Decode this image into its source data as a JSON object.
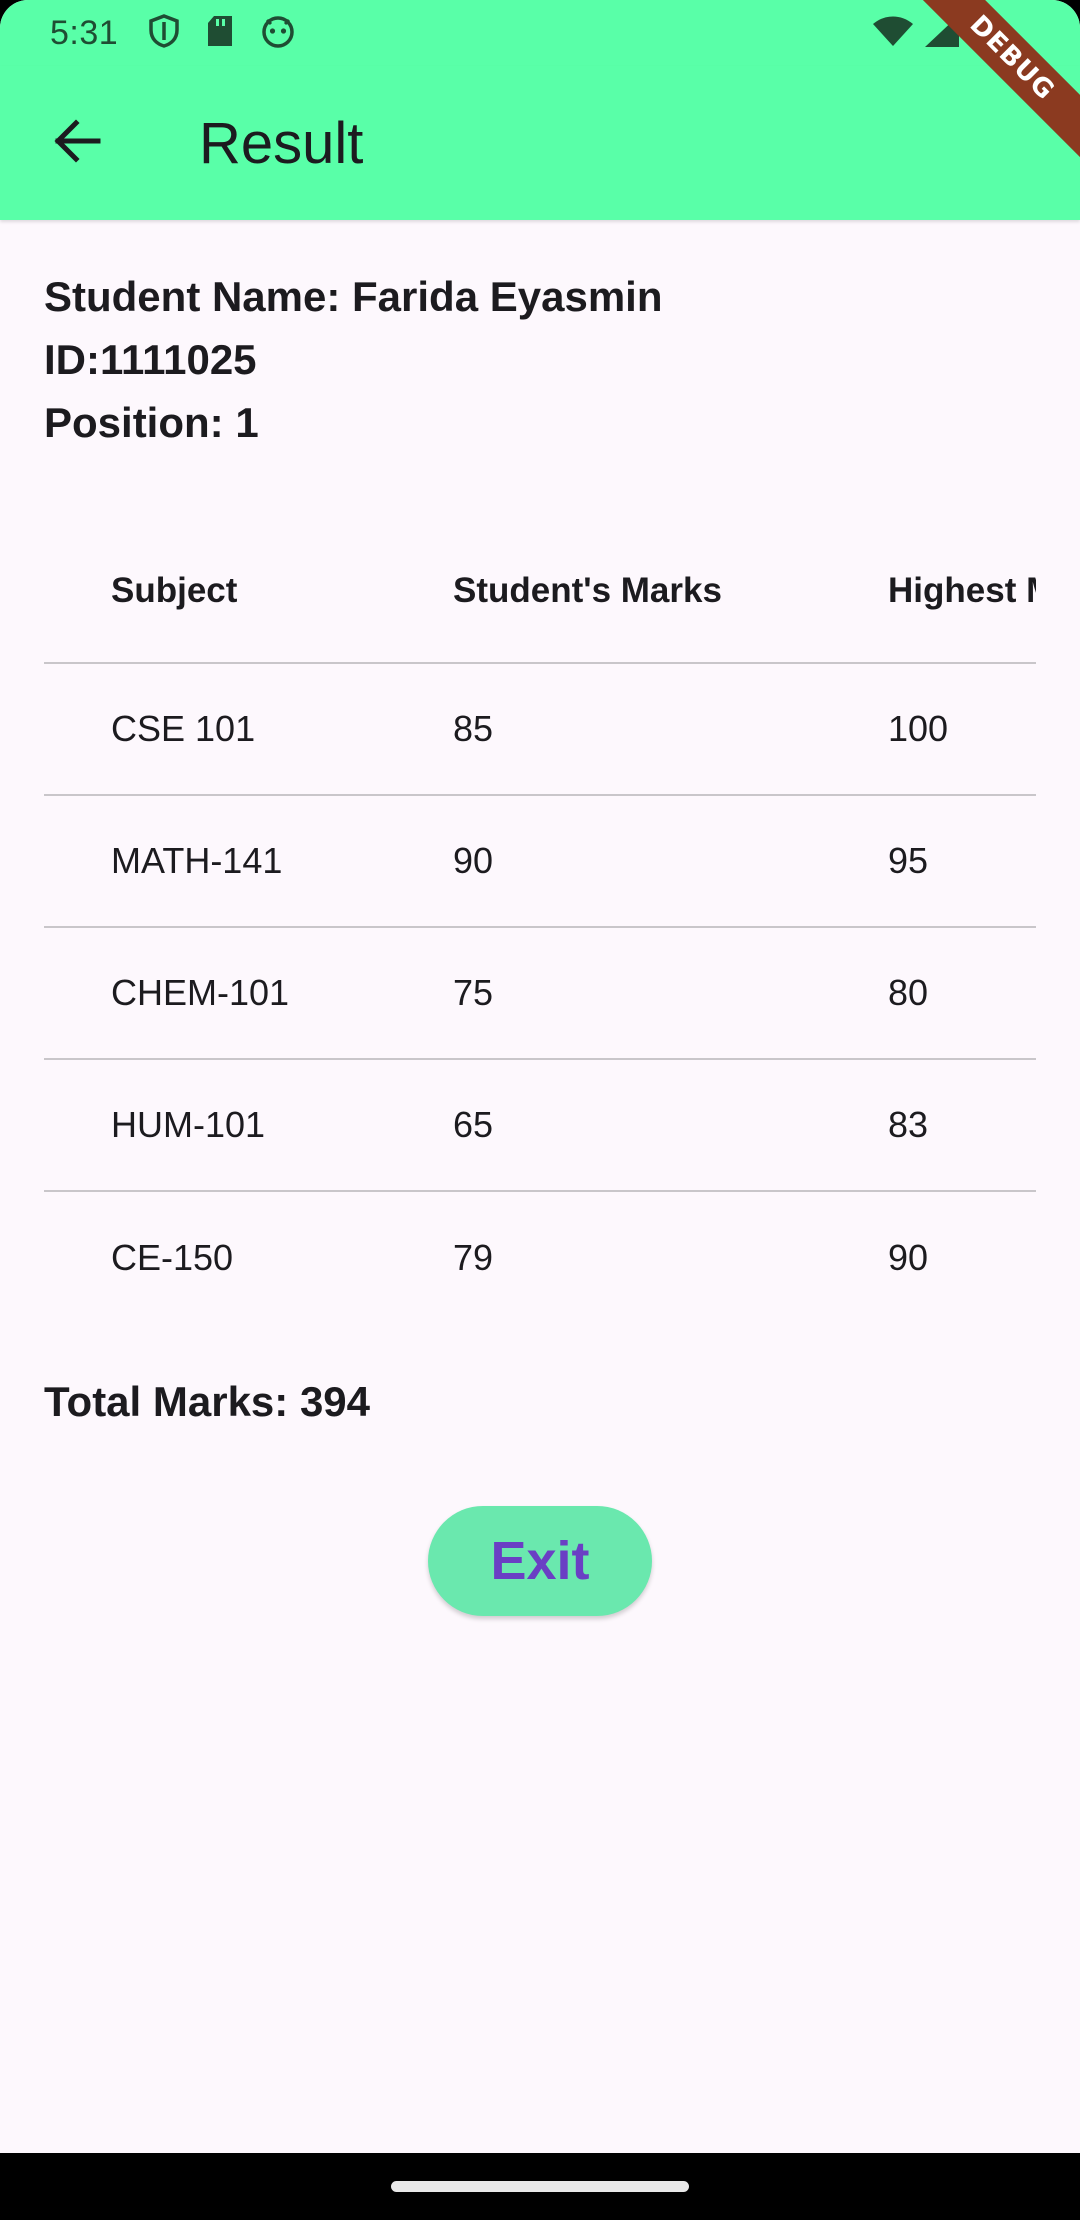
{
  "status_bar": {
    "time": "5:31",
    "left_icons": [
      "shield-icon",
      "sd-card-icon",
      "android-icon"
    ],
    "right_icons": [
      "wifi-icon",
      "cell-signal-icon",
      "battery-icon"
    ]
  },
  "app_bar": {
    "title": "Result",
    "back_icon": "arrow-back-icon",
    "color": "#59ffa8"
  },
  "debug_banner": "DEBUG",
  "student": {
    "name_line": "Student Name: Farida Eyasmin",
    "id_line": "ID:1111025",
    "position_line": "Position: 1"
  },
  "table": {
    "headers": [
      "Subject",
      "Student's Marks",
      "Highest Marks"
    ],
    "rows": [
      [
        "CSE 101",
        "85",
        "100"
      ],
      [
        "MATH-141",
        "90",
        "95"
      ],
      [
        "CHEM-101",
        "75",
        "80"
      ],
      [
        "HUM-101",
        "65",
        "83"
      ],
      [
        "CE-150",
        "79",
        "90"
      ]
    ]
  },
  "total_line": "Total Marks: 394",
  "exit_button": {
    "label": "Exit",
    "bg_color": "#6ae8ae",
    "text_color": "#6a3fc4"
  }
}
